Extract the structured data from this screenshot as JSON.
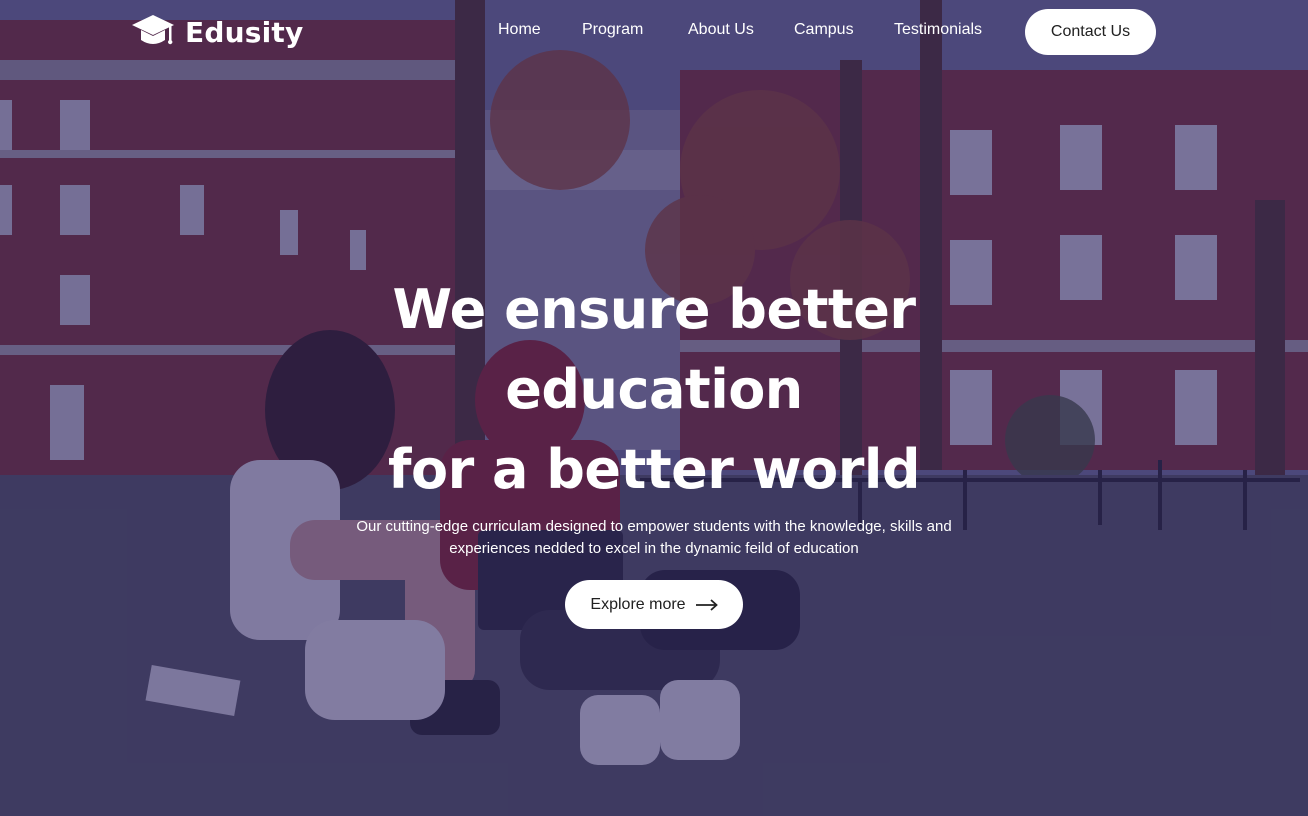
{
  "brand": {
    "name": "Edusity",
    "logo_icon": "graduation-cap-icon"
  },
  "nav": {
    "items": [
      {
        "label": "Home"
      },
      {
        "label": "Program"
      },
      {
        "label": "About Us"
      },
      {
        "label": "Campus"
      },
      {
        "label": "Testimonials"
      }
    ],
    "contact_label": "Contact Us"
  },
  "hero": {
    "headline_line1": "We ensure better education",
    "headline_line2": "for a better world",
    "subtitle_line1": "Our cutting-edge curriculam designed to empower students with the knowledge, skills and",
    "subtitle_line2": "experiences nedded to excel in the dynamic feild of education",
    "cta_label": "Explore more",
    "cta_icon": "arrow-right-icon"
  },
  "colors": {
    "overlay": "#241c5c",
    "button_bg": "#ffffff",
    "text_primary": "#ffffff",
    "button_text": "#212121"
  }
}
